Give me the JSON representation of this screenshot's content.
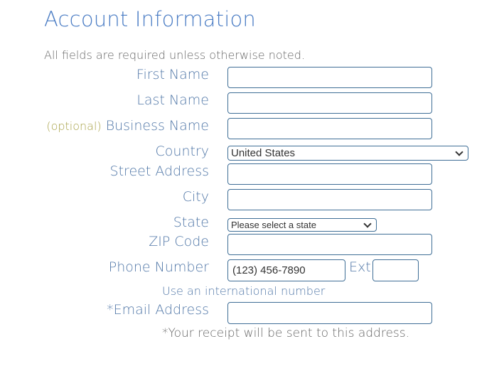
{
  "header": {
    "title": "Account Information",
    "required_note": "All fields are required unless otherwise noted."
  },
  "form": {
    "first_name": {
      "label": "First Name",
      "value": ""
    },
    "last_name": {
      "label": "Last Name",
      "value": ""
    },
    "business_name": {
      "optional_tag": "(optional)",
      "label": "Business Name",
      "value": ""
    },
    "country": {
      "label": "Country",
      "selected": "United States"
    },
    "street_address": {
      "label": "Street Address",
      "value": ""
    },
    "city": {
      "label": "City",
      "value": ""
    },
    "state": {
      "label": "State",
      "selected": "Please select a state"
    },
    "zip_code": {
      "label": "ZIP Code",
      "value": ""
    },
    "phone": {
      "label": "Phone Number",
      "placeholder": "(123) 456-7890",
      "ext_label": "Ext",
      "ext_value": ""
    },
    "international_link": "Use an international number",
    "email": {
      "label": "*Email Address",
      "value": ""
    },
    "receipt_note": "*Your receipt will be sent to this address."
  }
}
